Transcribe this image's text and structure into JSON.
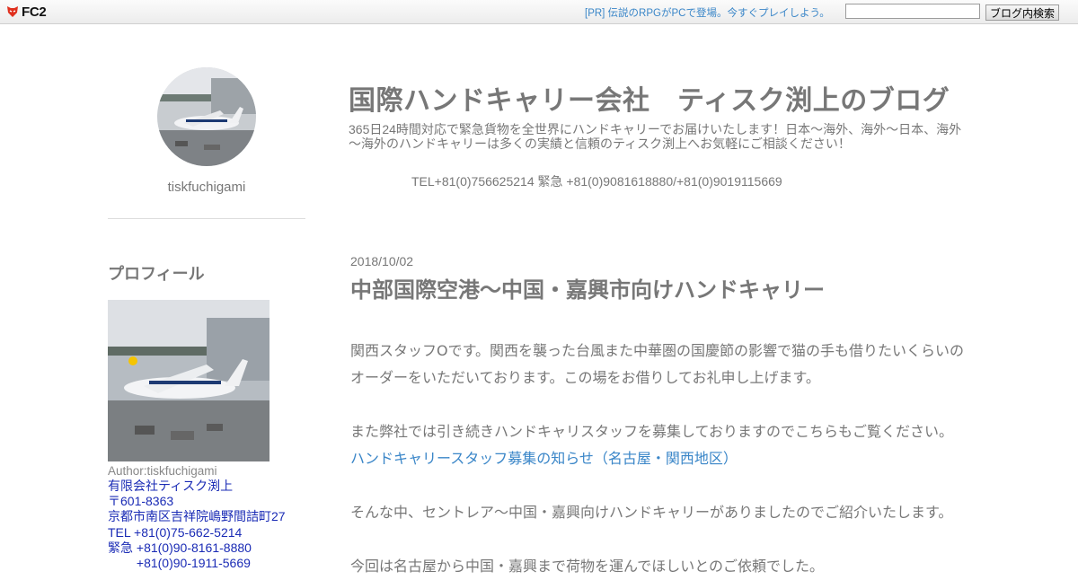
{
  "topbar": {
    "logo_text": "FC2",
    "pr_link": "[PR] 伝説のRPGがPCで登場。今すぐプレイしよう。",
    "search_placeholder": "",
    "search_button": "ブログ内検索"
  },
  "sidebar": {
    "username": "tiskfuchigami",
    "profile_heading": "プロフィール",
    "author": "Author:tiskfuchigami",
    "profile_lines": [
      "有限会社ティスク渕上",
      "〒601-8363",
      "京都市南区吉祥院嶋野間詰町27",
      "TEL +81(0)75-662-5214",
      "緊急 +81(0)90-8161-8880",
      "　　 +81(0)90-1911-5669"
    ]
  },
  "header": {
    "title": "国際ハンドキャリー会社　ティスク渕上のブログ",
    "description": "365日24時間対応で緊急貨物を全世界にハンドキャリーでお届けいたします！日本～海外、海外～日本、海外～海外のハンドキャリーは多くの実績と信頼のティスク渕上へお気軽にご相談ください！",
    "tel": "TEL+81(0)756625214 緊急 +81(0)9081618880/+81(0)9019115669"
  },
  "post": {
    "date": "2018/10/02",
    "title": "中部国際空港～中国・嘉興市向けハンドキャリー",
    "para1_line1": "関西スタッフOです。関西を襲った台風また中華圏の国慶節の影響で猫の手も借りたいくらいの",
    "para1_line2": "オーダーをいただいております。この場をお借りしてお礼申し上げます。",
    "para2_line1": "また弊社では引き続きハンドキャリスタッフを募集しておりますのでこちらもご覧ください。",
    "link_text": "ハンドキャリースタッフ募集の知らせ（名古屋・関西地区）",
    "para3_line1": "そんな中、セントレア～中国・嘉興向けハンドキャリーがありましたのでご紹介いたします。",
    "para4_line1": "今回は名古屋から中国・嘉興まで荷物を運んでほしいとのご依頼でした。"
  }
}
